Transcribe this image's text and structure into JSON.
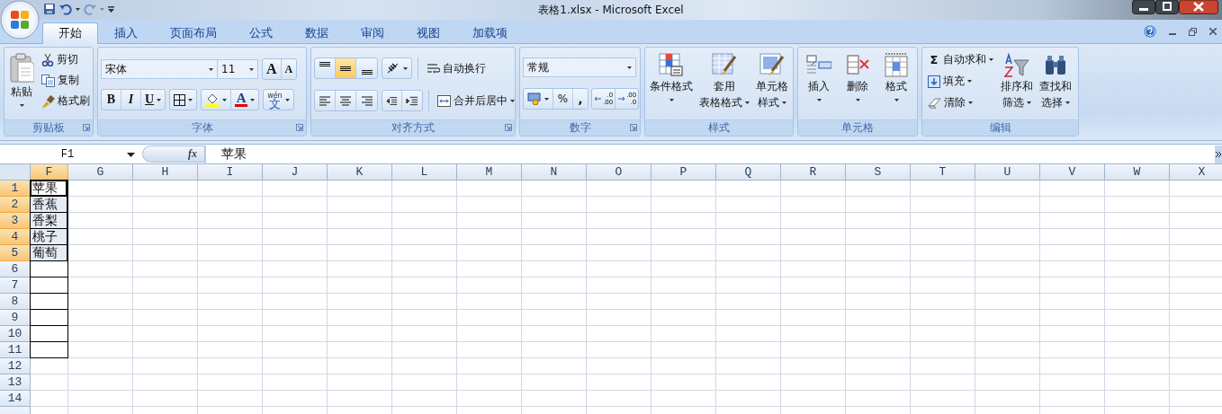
{
  "window": {
    "title": "表格1.xlsx  -  Microsoft Excel"
  },
  "quick_access": {
    "undo": {
      "disabled": false
    },
    "redo": {
      "disabled": true
    }
  },
  "tabs": [
    {
      "label": "开始",
      "selected": true
    },
    {
      "label": "插入",
      "selected": false
    },
    {
      "label": "页面布局",
      "selected": false
    },
    {
      "label": "公式",
      "selected": false
    },
    {
      "label": "数据",
      "selected": false
    },
    {
      "label": "审阅",
      "selected": false
    },
    {
      "label": "视图",
      "selected": false
    },
    {
      "label": "加载项",
      "selected": false
    }
  ],
  "ribbon": {
    "clipboard": {
      "title": "剪贴板",
      "paste": "粘贴",
      "cut": "剪切",
      "copy": "复制",
      "format_painter": "格式刷"
    },
    "font": {
      "title": "字体",
      "font_name": "宋体",
      "font_size": "11",
      "grow": "A",
      "shrink": "A",
      "bold": "B",
      "italic": "I",
      "underline": "U",
      "font_color": "A",
      "phonetic_pinyin": "wén",
      "phonetic": "文"
    },
    "alignment": {
      "title": "对齐方式",
      "vertical_align": [
        {
          "selected": false
        },
        {
          "selected": true
        },
        {
          "selected": false
        }
      ],
      "wrap_text": "自动换行",
      "merge_center": "合并后居中"
    },
    "number": {
      "title": "数字",
      "format": "常规",
      "percent": "%",
      "comma": ",",
      "increase_decimal": [
        ".0",
        ".00"
      ],
      "decrease_decimal": [
        ".00",
        ".0"
      ]
    },
    "styles": {
      "title": "样式",
      "buttons": [
        {
          "lines": [
            "条件格式"
          ]
        },
        {
          "lines": [
            "套用",
            "表格格式"
          ]
        },
        {
          "lines": [
            "单元格",
            "样式"
          ]
        }
      ]
    },
    "cells": {
      "title": "单元格",
      "buttons": [
        {
          "lines": [
            "插入"
          ]
        },
        {
          "lines": [
            "删除"
          ]
        },
        {
          "lines": [
            "格式"
          ]
        }
      ]
    },
    "editing": {
      "title": "编辑",
      "sigma": "Σ",
      "autosum": "自动求和",
      "fill": "填充",
      "clear": "清除",
      "sort": [
        "排序和",
        "筛选"
      ],
      "find": [
        "查找和",
        "选择"
      ]
    }
  },
  "formula_bar": {
    "name_box": "F1",
    "function_label": "fx",
    "formula": "苹果"
  },
  "grid": {
    "columns": [
      {
        "label": "F",
        "selected": true
      },
      {
        "label": "G",
        "selected": false
      },
      {
        "label": "H",
        "selected": false
      },
      {
        "label": "I",
        "selected": false
      },
      {
        "label": "J",
        "selected": false
      },
      {
        "label": "K",
        "selected": false
      },
      {
        "label": "L",
        "selected": false
      },
      {
        "label": "M",
        "selected": false
      },
      {
        "label": "N",
        "selected": false
      },
      {
        "label": "O",
        "selected": false
      },
      {
        "label": "P",
        "selected": false
      },
      {
        "label": "Q",
        "selected": false
      },
      {
        "label": "R",
        "selected": false
      },
      {
        "label": "S",
        "selected": false
      },
      {
        "label": "T",
        "selected": false
      },
      {
        "label": "U",
        "selected": false
      },
      {
        "label": "V",
        "selected": false
      },
      {
        "label": "W",
        "selected": false
      },
      {
        "label": "X",
        "selected": false
      }
    ],
    "rows": [
      {
        "label": "1",
        "selected": true,
        "cell": {
          "text": "苹果",
          "selected": true,
          "active": true,
          "bordered": true
        }
      },
      {
        "label": "2",
        "selected": true,
        "cell": {
          "text": "香蕉",
          "selected": true,
          "active": false,
          "bordered": true
        }
      },
      {
        "label": "3",
        "selected": true,
        "cell": {
          "text": "香梨",
          "selected": true,
          "active": false,
          "bordered": true
        }
      },
      {
        "label": "4",
        "selected": true,
        "cell": {
          "text": "桃子",
          "selected": true,
          "active": false,
          "bordered": true
        }
      },
      {
        "label": "5",
        "selected": true,
        "cell": {
          "text": "葡萄",
          "selected": true,
          "active": false,
          "bordered": true
        }
      },
      {
        "label": "6",
        "selected": false,
        "cell": {
          "selected": false,
          "active": false,
          "bordered": true
        }
      },
      {
        "label": "7",
        "selected": false,
        "cell": {
          "selected": false,
          "active": false,
          "bordered": true
        }
      },
      {
        "label": "8",
        "selected": false,
        "cell": {
          "selected": false,
          "active": false,
          "bordered": true
        }
      },
      {
        "label": "9",
        "selected": false,
        "cell": {
          "selected": false,
          "active": false,
          "bordered": true
        }
      },
      {
        "label": "10",
        "selected": false,
        "cell": {
          "selected": false,
          "active": false,
          "bordered": true
        }
      },
      {
        "label": "11",
        "selected": false,
        "cell": {
          "selected": false,
          "active": false,
          "bordered": true
        }
      },
      {
        "label": "12",
        "selected": false,
        "cell": {
          "selected": false,
          "active": false,
          "bordered": false
        }
      },
      {
        "label": "13",
        "selected": false,
        "cell": {
          "selected": false,
          "active": false,
          "bordered": false
        }
      },
      {
        "label": "14",
        "selected": false,
        "cell": {
          "selected": false,
          "active": false,
          "bordered": false
        }
      }
    ]
  }
}
